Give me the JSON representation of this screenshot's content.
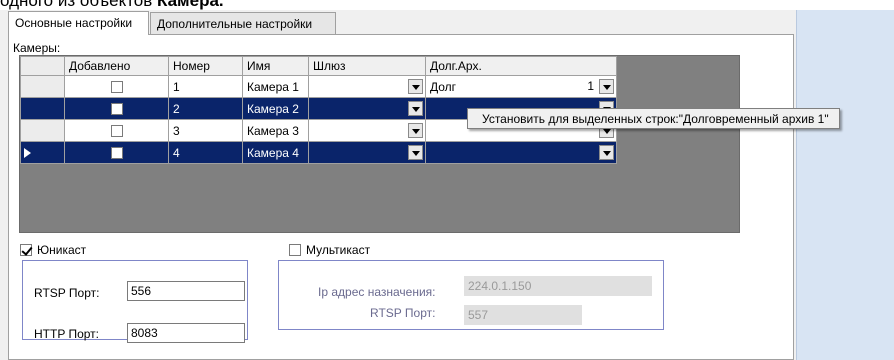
{
  "header": {
    "prefix": "одного из объектов ",
    "bold": "Камера."
  },
  "tabs": [
    {
      "label": "Основные настройки",
      "active": true
    },
    {
      "label": "Дополнительные настройки",
      "active": false
    }
  ],
  "cameras": {
    "label": "Камеры:",
    "columns": [
      "Добавлено",
      "Номер",
      "Имя",
      "Шлюз",
      "Долг.Арх."
    ],
    "rows": [
      {
        "number": "1",
        "name": "Камера 1",
        "gateway": "",
        "archive": "Долг",
        "archive_tail": "1",
        "selected": false,
        "current": false
      },
      {
        "number": "2",
        "name": "Камера 2",
        "gateway": "",
        "archive": "",
        "selected": true,
        "current": false
      },
      {
        "number": "3",
        "name": "Камера 3",
        "gateway": "",
        "archive": "",
        "selected": false,
        "current": false
      },
      {
        "number": "4",
        "name": "Камера 4",
        "gateway": "",
        "archive": "",
        "selected": true,
        "current": true
      }
    ]
  },
  "tooltip": "Установить для выделенных строк:\"Долговременный архив 1\"",
  "unicast": {
    "label": "Юникаст",
    "checked": true,
    "rtsp_label": "RTSP Порт:",
    "rtsp_value": "556",
    "http_label": "HTTP Порт:",
    "http_value": "8083"
  },
  "multicast": {
    "label": "Мультикаст",
    "checked": false,
    "ip_label": "Ip адрес назначения:",
    "ip_value": "224.0.1.150",
    "rtsp_label": "RTSP Порт:",
    "rtsp_value": "557"
  },
  "colors": {
    "selection": "#0a246a",
    "group_border": "#7f86c8",
    "right_panel": "#d8e4f3"
  }
}
